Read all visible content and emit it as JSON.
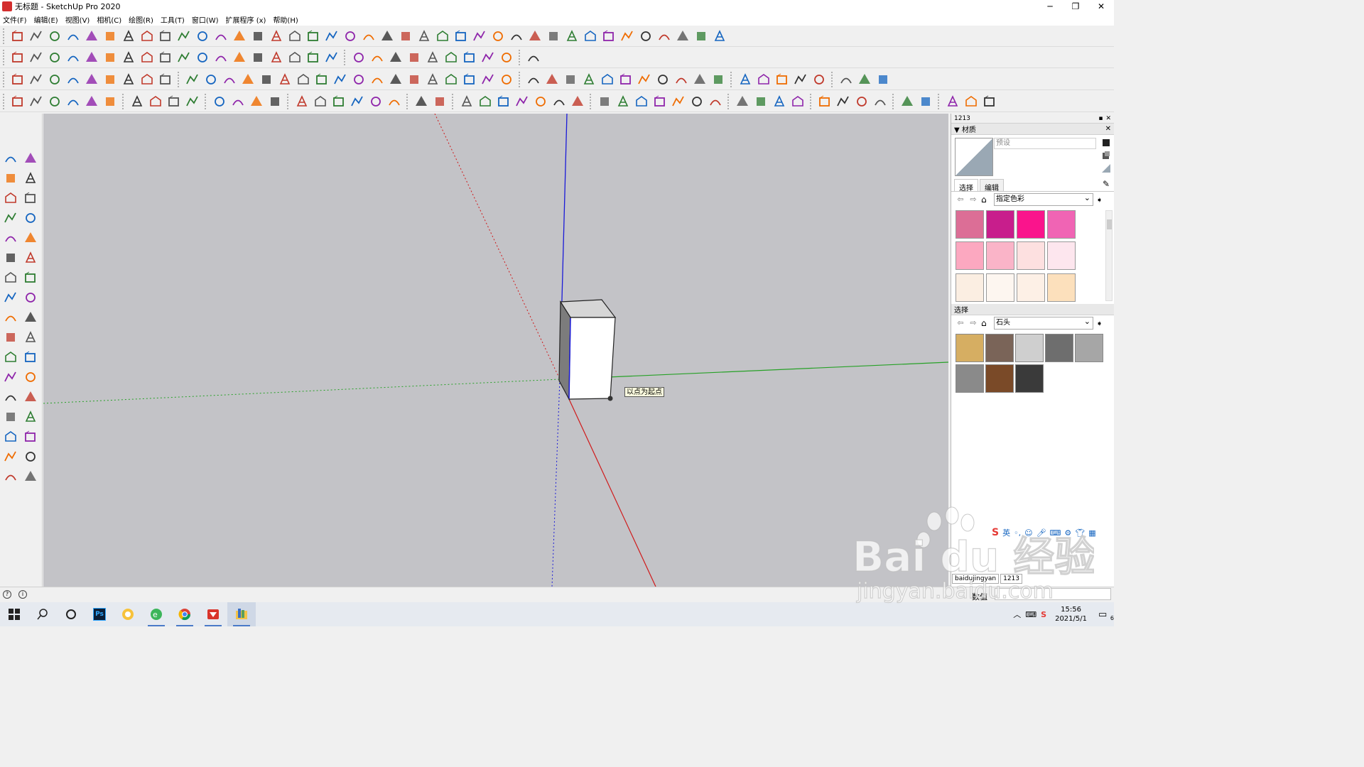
{
  "window": {
    "title": "无标题 - SketchUp Pro 2020",
    "controls": [
      "─",
      "❐",
      "✕"
    ]
  },
  "menu": {
    "items": [
      "文件(F)",
      "编辑(E)",
      "视图(V)",
      "相机(C)",
      "绘图(R)",
      "工具(T)",
      "窗口(W)",
      "扩展程序 (x)",
      "帮助(H)"
    ]
  },
  "viewport": {
    "background": "#c3c3c7",
    "tooltip": "以点为起点",
    "axis_colors": {
      "red": "#d0191a",
      "green": "#27a127",
      "blue": "#1a1ad8"
    }
  },
  "tray_panel": {
    "header": "1213",
    "section_title": "材质",
    "material_name_placeholder": "预设",
    "tabs": [
      "选择",
      "编辑"
    ],
    "library_select": "指定色彩",
    "swatches": [
      "#dc6e96",
      "#c81e8c",
      "#fa148c",
      "#f064b4",
      "#fca8c0",
      "#fab4c8",
      "#fde0e0",
      "#fde6ee",
      "#fbeee2",
      "#fdf6f0",
      "#fdf0e6",
      "#fce0bc"
    ],
    "secondary_section": "选择",
    "secondary_select": "石头",
    "stones": [
      "#d6ae62",
      "#7a6458",
      "#cfcfcf",
      "#6e6e6e",
      "#a6a6a6",
      "#8a8a8a",
      "#7a4a28",
      "#3a3a3a"
    ],
    "ime": {
      "logo": "S",
      "lang": "英"
    }
  },
  "status": {
    "tab_labels": [
      "baidujingyan",
      "1213"
    ],
    "measure_label": "数值"
  },
  "taskbar": {
    "time": "15:56",
    "date": "2021/5/1",
    "notification_count": "6",
    "ps_label": "Ps"
  },
  "watermark": {
    "brand": "Bai du 经验",
    "url": "jingyan.baidu.com"
  }
}
